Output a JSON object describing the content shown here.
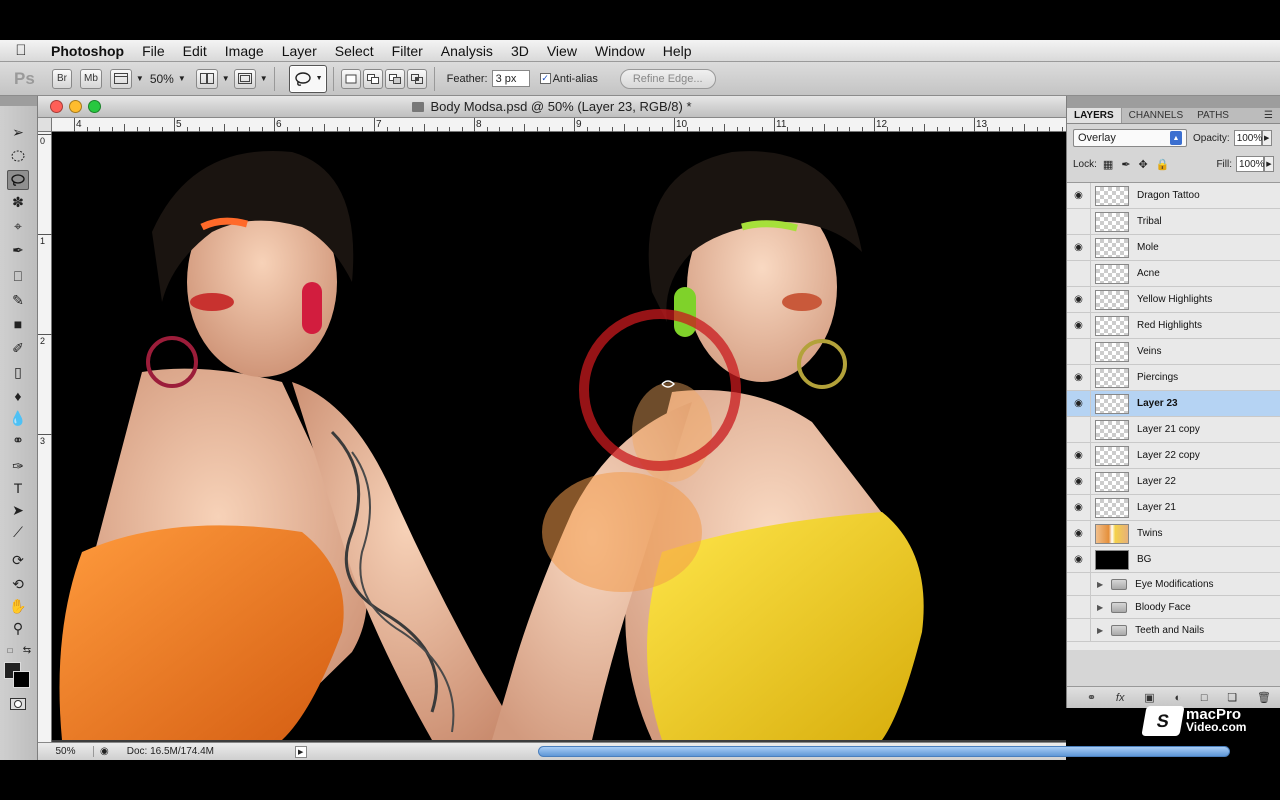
{
  "menubar": {
    "app": "Photoshop",
    "items": [
      "File",
      "Edit",
      "Image",
      "Layer",
      "Select",
      "Filter",
      "Analysis",
      "3D",
      "View",
      "Window",
      "Help"
    ]
  },
  "options": {
    "ps_logo": "Ps",
    "br_label": "Br",
    "mb_label": "Mb",
    "zoom": "50%",
    "feather_label": "Feather:",
    "feather_value": "3 px",
    "antialias_label": "Anti-alias",
    "antialias_checked": true,
    "refine_edge": "Refine Edge..."
  },
  "document": {
    "title": "Body Modsa.psd @ 50% (Layer 23, RGB/8) *",
    "ruler_h_labels": [
      "4",
      "5",
      "6",
      "7",
      "8",
      "9",
      "10",
      "11",
      "12",
      "13"
    ],
    "ruler_v_labels": [
      "0",
      "1",
      "2",
      "3"
    ],
    "status_zoom": "50%",
    "status_doc": "Doc: 16.5M/174.4M"
  },
  "layers_panel": {
    "tabs": [
      "LAYERS",
      "CHANNELS",
      "PATHS"
    ],
    "blend_mode": "Overlay",
    "opacity_label": "Opacity:",
    "opacity_value": "100%",
    "lock_label": "Lock:",
    "fill_label": "Fill:",
    "fill_value": "100%",
    "layers": [
      {
        "name": "Dragon Tattoo",
        "visible": true
      },
      {
        "name": "Tribal",
        "visible": false
      },
      {
        "name": "Mole",
        "visible": true
      },
      {
        "name": "Acne",
        "visible": false
      },
      {
        "name": "Yellow Highlights",
        "visible": true
      },
      {
        "name": "Red Highlights",
        "visible": true
      },
      {
        "name": "Veins",
        "visible": false
      },
      {
        "name": "Piercings",
        "visible": true
      },
      {
        "name": "Layer 23",
        "visible": true,
        "selected": true
      },
      {
        "name": "Layer 21 copy",
        "visible": false
      },
      {
        "name": "Layer 22 copy",
        "visible": true
      },
      {
        "name": "Layer 22",
        "visible": true
      },
      {
        "name": "Layer 21",
        "visible": true
      },
      {
        "name": "Twins",
        "visible": true
      },
      {
        "name": "BG",
        "visible": true
      }
    ],
    "groups": [
      "Eye Modifications",
      "Bloody Face",
      "Teeth and Nails"
    ]
  },
  "watermark": {
    "line1": "macPro",
    "line2": "Video.com"
  },
  "colors": {
    "accent": "#3b6fd0",
    "selection": "#b5d3f3",
    "close": "#ff5f57",
    "minimize": "#febc2e",
    "zoom": "#28c840"
  }
}
